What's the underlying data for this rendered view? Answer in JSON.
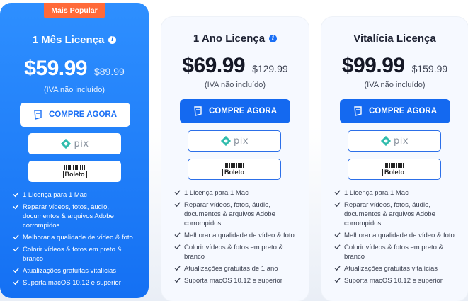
{
  "plans": [
    {
      "badge": "Mais Popular",
      "title": "1 Mês Licença",
      "price": "$59.99",
      "old_price": "$89.99",
      "vat": "(IVA não incluído)",
      "buy_label": "COMPRE AGORA",
      "pix_label": "pix",
      "boleto_label": "Boleto",
      "features": [
        "1 Licença para 1 Mac",
        "Reparar vídeos, fotos, áudio, documentos & arquivos Adobe corrompidos",
        "Melhorar a qualidade de vídeo & foto",
        "Colorir vídeos & fotos em preto & branco",
        "Atualizações gratuitas vitalícias",
        "Suporta macOS 10.12 e superior"
      ]
    },
    {
      "title": "1 Ano Licença",
      "price": "$69.99",
      "old_price": "$129.99",
      "vat": "(IVA não incluído)",
      "buy_label": "COMPRE AGORA",
      "pix_label": "pix",
      "boleto_label": "Boleto",
      "features": [
        "1 Licença para 1 Mac",
        "Reparar vídeos, fotos, áudio, documentos & arquivos Adobe corrompidos",
        "Melhorar a qualidade de vídeo & foto",
        "Colorir vídeos & fotos em preto & branco",
        "Atualizações gratuitas de 1 ano",
        "Suporta macOS 10.12 e superior"
      ]
    },
    {
      "title": "Vitalícia Licença",
      "price": "$99.99",
      "old_price": "$159.99",
      "vat": "(IVA não incluído)",
      "buy_label": "COMPRE AGORA",
      "pix_label": "pix",
      "boleto_label": "Boleto",
      "features": [
        "1 Licença para 1 Mac",
        "Reparar vídeos, fotos, áudio, documentos & arquivos Adobe corrompidos",
        "Melhorar a qualidade de vídeo & foto",
        "Colorir vídeos & fotos em preto & branco",
        "Atualizações gratuitas vitalícias",
        "Suporta macOS 10.12 e superior"
      ]
    }
  ],
  "colors": {
    "featured_bg": "#1a78f5",
    "badge": "#ff6a39",
    "button_blue": "#1469f0",
    "pix_teal": "#32bcad"
  },
  "icons": {
    "info": "info-icon",
    "cart": "shopping-cart-icon",
    "check": "checkmark-icon",
    "pix": "pix-logo",
    "boleto": "boleto-logo"
  }
}
